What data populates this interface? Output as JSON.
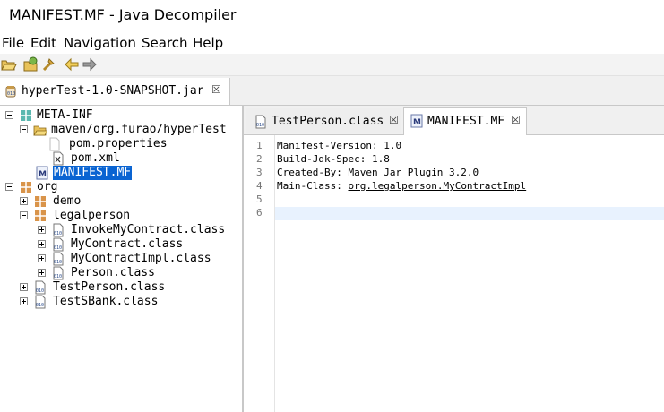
{
  "window": {
    "title": "MANIFEST.MF - Java Decompiler"
  },
  "menu": [
    "File",
    "Edit",
    "Navigation",
    "Search",
    "Help"
  ],
  "toolbar": {
    "icons": [
      "open-file-icon",
      "open-type-icon",
      "search-icon",
      "back-arrow-icon",
      "forward-arrow-icon"
    ]
  },
  "file_tab": {
    "label": "hyperTest-1.0-SNAPSHOT.jar",
    "close": "☒"
  },
  "tree": {
    "nodes": [
      {
        "label": "META-INF"
      },
      {
        "label": "maven/org.furao/hyperTest"
      },
      {
        "label": "pom.properties"
      },
      {
        "label": "pom.xml"
      },
      {
        "label": "MANIFEST.MF"
      },
      {
        "label": "org"
      },
      {
        "label": "demo"
      },
      {
        "label": "legalperson"
      },
      {
        "label": "InvokeMyContract.class"
      },
      {
        "label": "MyContract.class"
      },
      {
        "label": "MyContractImpl.class"
      },
      {
        "label": "Person.class"
      },
      {
        "label": "TestPerson.class"
      },
      {
        "label": "TestSBank.class"
      }
    ]
  },
  "editor_tabs": [
    {
      "label": "TestPerson.class",
      "close": "☒"
    },
    {
      "label": "MANIFEST.MF",
      "close": "☒"
    }
  ],
  "editor": {
    "line_numbers": [
      "1",
      "2",
      "3",
      "4",
      "5",
      "6"
    ],
    "lines": [
      {
        "text": "Manifest-Version: 1.0"
      },
      {
        "text": "Build-Jdk-Spec: 1.8"
      },
      {
        "text": "Created-By: Maven Jar Plugin 3.2.0"
      },
      {
        "prefix": "Main-Class: ",
        "link": "org.legalperson.MyContractImpl"
      },
      {
        "text": ""
      },
      {
        "text": ""
      }
    ]
  },
  "colors": {
    "selection": "#0a64d2",
    "current_line": "#e8f2fe"
  }
}
